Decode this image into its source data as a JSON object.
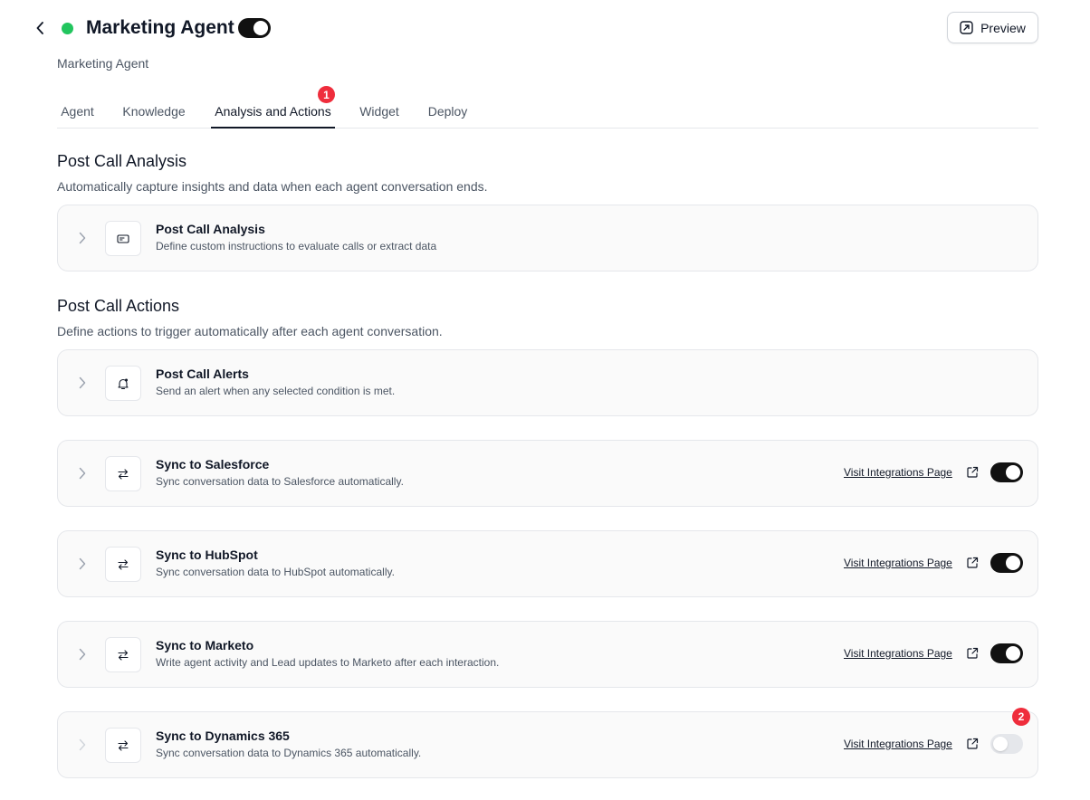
{
  "header": {
    "title": "Marketing Agent",
    "subtitle": "Marketing Agent",
    "status_color": "#22c55e",
    "agent_enabled": true,
    "preview_label": "Preview"
  },
  "tabs": [
    {
      "label": "Agent",
      "active": false
    },
    {
      "label": "Knowledge",
      "active": false
    },
    {
      "label": "Analysis and Actions",
      "active": true,
      "badge": "1"
    },
    {
      "label": "Widget",
      "active": false
    },
    {
      "label": "Deploy",
      "active": false
    }
  ],
  "colors": {
    "accent": "#111111",
    "badge": "#ef2d3c",
    "status": "#22c55e"
  },
  "analysis": {
    "title": "Post Call Analysis",
    "description": "Automatically capture insights and data when each agent conversation ends.",
    "card": {
      "icon": "tag-icon",
      "title": "Post Call Analysis",
      "description": "Define custom instructions to evaluate calls or extract data"
    }
  },
  "actions": {
    "title": "Post Call Actions",
    "description": "Define actions to trigger automatically after each agent conversation.",
    "alerts": {
      "icon": "bell-icon",
      "title": "Post Call Alerts",
      "description": "Send an alert when any selected condition is met."
    },
    "syncs": [
      {
        "icon": "sync-arrows-icon",
        "title": "Sync to Salesforce",
        "description": "Sync conversation data to Salesforce automatically.",
        "link": "Visit Integrations Page",
        "enabled": true
      },
      {
        "icon": "sync-arrows-icon",
        "title": "Sync to HubSpot",
        "description": "Sync conversation data to HubSpot automatically.",
        "link": "Visit Integrations Page",
        "enabled": true
      },
      {
        "icon": "sync-arrows-icon",
        "title": "Sync to Marketo",
        "description": "Write agent activity and Lead updates to Marketo after each interaction.",
        "link": "Visit Integrations Page",
        "enabled": true
      },
      {
        "icon": "sync-arrows-icon",
        "title": "Sync to Dynamics 365",
        "description": "Sync conversation data to Dynamics 365 automatically.",
        "link": "Visit Integrations Page",
        "enabled": false,
        "badge": "2"
      }
    ]
  }
}
